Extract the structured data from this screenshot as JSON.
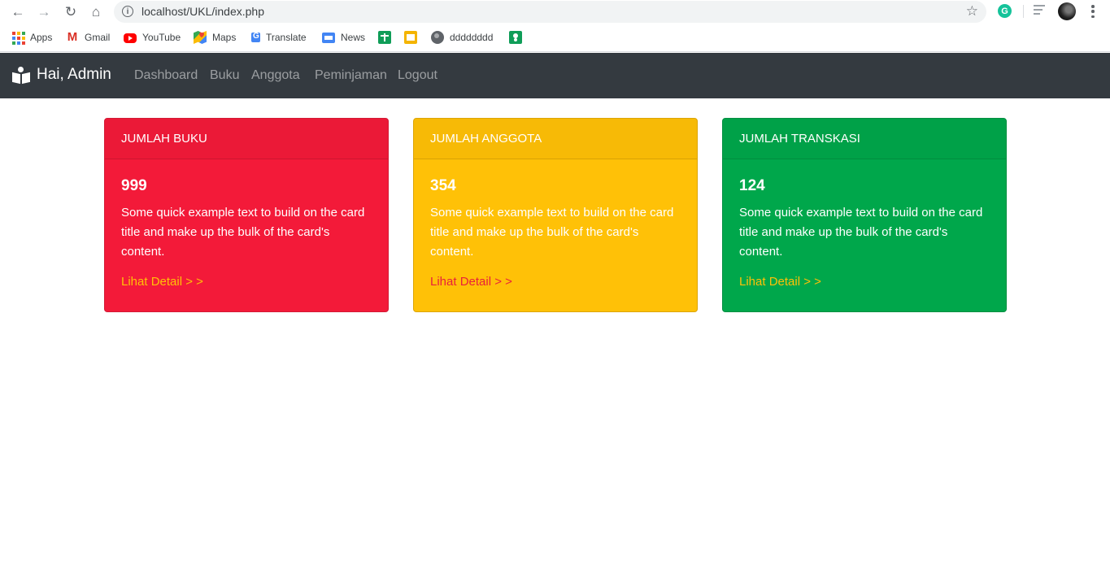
{
  "browser": {
    "url": "localhost/UKL/index.php",
    "extension_letter": "G",
    "bookmarks": [
      {
        "label": "Apps",
        "icon": "apps-grid-icon"
      },
      {
        "label": "Gmail",
        "icon": "gmail-icon"
      },
      {
        "label": "YouTube",
        "icon": "youtube-icon"
      },
      {
        "label": "Maps",
        "icon": "maps-icon"
      },
      {
        "label": "Translate",
        "icon": "translate-icon"
      },
      {
        "label": "News",
        "icon": "news-icon"
      },
      {
        "label": "",
        "icon": "sheets-icon"
      },
      {
        "label": "",
        "icon": "slides-icon"
      },
      {
        "label": "dddddddd",
        "icon": "globe-icon"
      },
      {
        "label": "",
        "icon": "classroom-icon"
      }
    ]
  },
  "navbar": {
    "brand": "Hai, Admin",
    "brand_icon": "reader-icon",
    "links": [
      "Dashboard",
      "Buku",
      "Anggota",
      "Peminjaman",
      "Logout"
    ]
  },
  "cards": [
    {
      "header": "JUMLAH BUKU",
      "count": "999",
      "text": "Some quick example text to build on the card title and make up the bulk of the card's content.",
      "link": "Lihat Detail > >",
      "bg": "#f31a39",
      "border": "#d31a35",
      "text_color": "#ffffff",
      "link_color": "#ffc107"
    },
    {
      "header": "JUMLAH ANGGOTA",
      "count": "354",
      "text": "Some quick example text to build on the card title and make up the bulk of the card's content.",
      "link": "Lihat Detail > >",
      "bg": "#ffc107",
      "border": "#dca506",
      "text_color": "#ffffff",
      "link_color": "#e8213a"
    },
    {
      "header": "JUMLAH TRANSKASI",
      "count": "124",
      "text": "Some quick example text to build on the card title and make up the bulk of the card's content.",
      "link": "Lihat Detail > >",
      "bg": "#00a74b",
      "border": "#018f41",
      "text_color": "#ffffff",
      "link_color": "#ffc107"
    }
  ],
  "colors": {
    "navbar_bg": "#343a40",
    "nav_link": "rgba(255,255,255,0.5)"
  }
}
